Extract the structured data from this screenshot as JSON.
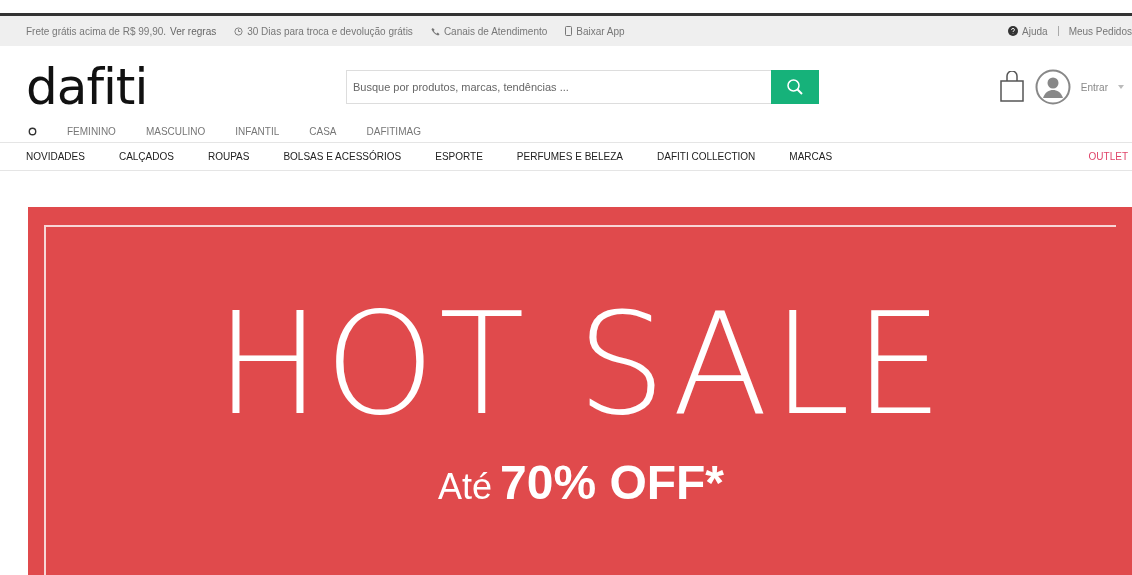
{
  "top_bar": {
    "items": [
      {
        "kind": "text",
        "label": "Frete grátis acima de R$ 99,90."
      },
      {
        "kind": "link",
        "label": "Ver regras"
      },
      {
        "kind": "clock",
        "label": "30 Dias para troca e devolução grátis"
      },
      {
        "kind": "phone",
        "label": "Canais de Atendimento"
      },
      {
        "kind": "mobile",
        "label": "Baixar App"
      }
    ],
    "right": [
      {
        "kind": "help",
        "label": "Ajuda"
      },
      {
        "kind": "link",
        "label": "Meus Pedidos"
      }
    ]
  },
  "header": {
    "logo": "dafiti",
    "search": {
      "placeholder": "Busque por produtos, marcas, tendências ..."
    },
    "login": "Entrar"
  },
  "categories": [
    {
      "label": "FEMININO",
      "selected": false
    },
    {
      "label": "MASCULINO",
      "selected": false
    },
    {
      "label": "INFANTIL",
      "selected": false
    },
    {
      "label": "CASA",
      "selected": false
    },
    {
      "label": "DAFITIMAG",
      "selected": false
    }
  ],
  "nav": [
    {
      "label": "NOVIDADES",
      "highlight": false
    },
    {
      "label": "CALÇADOS",
      "highlight": false
    },
    {
      "label": "ROUPAS",
      "highlight": false
    },
    {
      "label": "BOLSAS E ACESSÓRIOS",
      "highlight": false
    },
    {
      "label": "ESPORTE",
      "highlight": false
    },
    {
      "label": "PERFUMES E BELEZA",
      "highlight": false
    },
    {
      "label": "DAFITI COLLECTION",
      "highlight": false
    },
    {
      "label": "MARCAS",
      "highlight": false
    },
    {
      "label": "OUTLET",
      "highlight": true
    }
  ],
  "banner": {
    "title": "HOT SALE",
    "prefix": "Até",
    "offer": "70% OFF*"
  }
}
